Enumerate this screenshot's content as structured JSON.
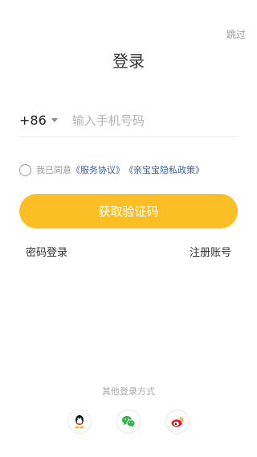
{
  "header": {
    "skip_label": "跳过",
    "title": "登录"
  },
  "phone": {
    "country_code": "+86",
    "placeholder": "输入手机号码",
    "value": ""
  },
  "agreement": {
    "prefix": "我已同意",
    "service_link": "《服务协议》",
    "privacy_link": "《亲宝宝隐私政策》"
  },
  "primary_button": {
    "label": "获取验证码",
    "color": "#fbbe25"
  },
  "links": {
    "password_login": "密码登录",
    "register": "注册账号"
  },
  "other_login": {
    "label": "其他登录方式",
    "providers": [
      {
        "name": "QQ",
        "icon": "qq-icon"
      },
      {
        "name": "WeChat",
        "icon": "wechat-icon",
        "color": "#36b04a"
      },
      {
        "name": "Weibo",
        "icon": "weibo-icon",
        "color": "#e6162d"
      }
    ]
  }
}
